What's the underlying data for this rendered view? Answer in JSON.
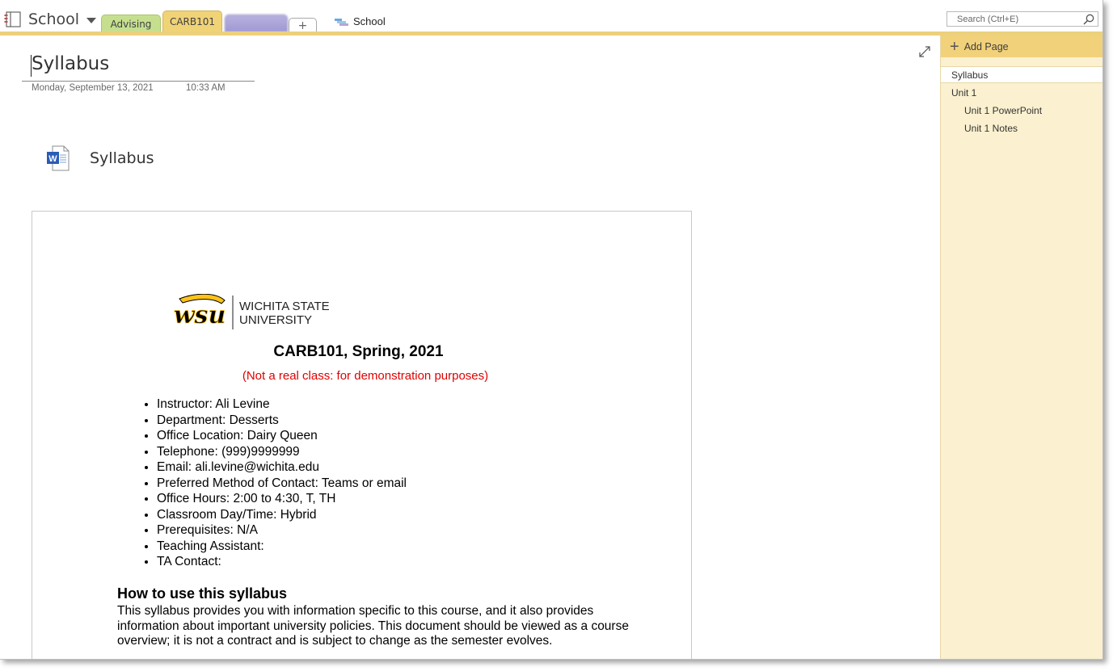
{
  "notebook": {
    "name": "School"
  },
  "sections": {
    "tabs": [
      {
        "label": "Advising",
        "color": "#c6df8f"
      },
      {
        "label": "CARB101",
        "color": "#f0d277"
      },
      {
        "label": "",
        "color": "#a79fd7"
      }
    ],
    "add_label": "+",
    "section_group": "School"
  },
  "search": {
    "placeholder": "Search (Ctrl+E)"
  },
  "page": {
    "title": "Syllabus",
    "date": "Monday, September 13, 2021",
    "time": "10:33 AM",
    "attachment": {
      "name": "Syllabus",
      "icon": "word-file-icon"
    }
  },
  "document": {
    "logo": {
      "line1": "WICHITA STATE",
      "line2": "UNIVERSITY",
      "mark": "wsu"
    },
    "title": "CARB101, Spring, 2021",
    "subtitle": "(Not a real class: for demonstration purposes)",
    "items": [
      "Instructor: Ali Levine",
      "Department: Desserts",
      "Office Location: Dairy Queen",
      "Telephone: (999)9999999",
      "Email: ali.levine@wichita.edu",
      "Preferred Method of Contact: Teams or email",
      "Office Hours: 2:00 to 4:30, T, TH",
      "Classroom Day/Time: Hybrid",
      "Prerequisites: N/A",
      "Teaching Assistant:",
      "TA Contact:"
    ],
    "heading": "How to use this syllabus",
    "paragraph": "This syllabus provides you with information specific to this course, and it also provides information about important university policies. This document should be viewed as a course overview; it is not a contract and is subject to change as the semester evolves."
  },
  "sidebar": {
    "add_page": "Add Page",
    "pages": [
      {
        "label": "Syllabus",
        "level": 0,
        "selected": true
      },
      {
        "label": "Unit 1",
        "level": 0,
        "selected": false
      },
      {
        "label": "Unit 1 PowerPoint",
        "level": 1,
        "selected": false
      },
      {
        "label": "Unit 1 Notes",
        "level": 1,
        "selected": false
      }
    ]
  }
}
